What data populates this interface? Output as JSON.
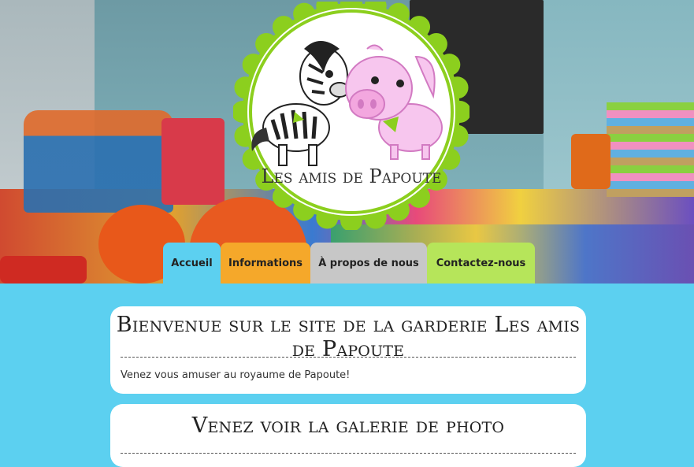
{
  "logo": {
    "text": "Les amis de Papoute"
  },
  "nav": {
    "items": [
      {
        "label": "Accueil"
      },
      {
        "label": "Informations"
      },
      {
        "label": "À propos de nous"
      },
      {
        "label": "Contactez-nous"
      }
    ]
  },
  "colors": {
    "page_bg": "#5cd0f0",
    "tab_accueil": "#5cd0f0",
    "tab_informations": "#f5a82a",
    "tab_apropos": "#c7c7c7",
    "tab_contact": "#b6e55a",
    "logo_ring": "#8ccf1e"
  },
  "welcome": {
    "title": "Bienvenue sur le site de la garderie Les amis de Papoute",
    "text": "Venez vous amuser au royaume de Papoute!"
  },
  "gallery": {
    "title": "Venez voir la galerie de photo"
  }
}
